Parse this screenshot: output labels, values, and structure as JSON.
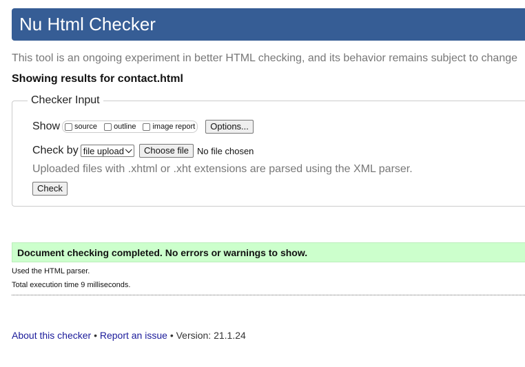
{
  "header": {
    "title": "Nu Html Checker"
  },
  "tagline": "This tool is an ongoing experiment in better HTML checking, and its behavior remains subject to change",
  "showing_results": "Showing results for contact.html",
  "checker_input": {
    "legend": "Checker Input",
    "show_label": "Show",
    "show_options": [
      {
        "label": "source",
        "checked": false
      },
      {
        "label": "outline",
        "checked": false
      },
      {
        "label": "image report",
        "checked": false
      }
    ],
    "options_button": "Options...",
    "check_by_label": "Check by",
    "check_by_selected": "file upload",
    "choose_file_button": "Choose file",
    "file_status": "No file chosen",
    "hint": "Uploaded files with .xhtml or .xht extensions are parsed using the XML parser.",
    "check_button": "Check"
  },
  "result": {
    "message": "Document checking completed. No errors or warnings to show."
  },
  "details": {
    "parser": "Used the HTML parser.",
    "execution_time": "Total execution time 9 milliseconds."
  },
  "footer": {
    "about_link": "About this checker",
    "separator": "•",
    "report_link": "Report an issue",
    "version": "Version: 21.1.24"
  },
  "colors": {
    "header_bg": "#365d95",
    "success_bg": "#ccffcc",
    "link": "#1a1a9a"
  }
}
